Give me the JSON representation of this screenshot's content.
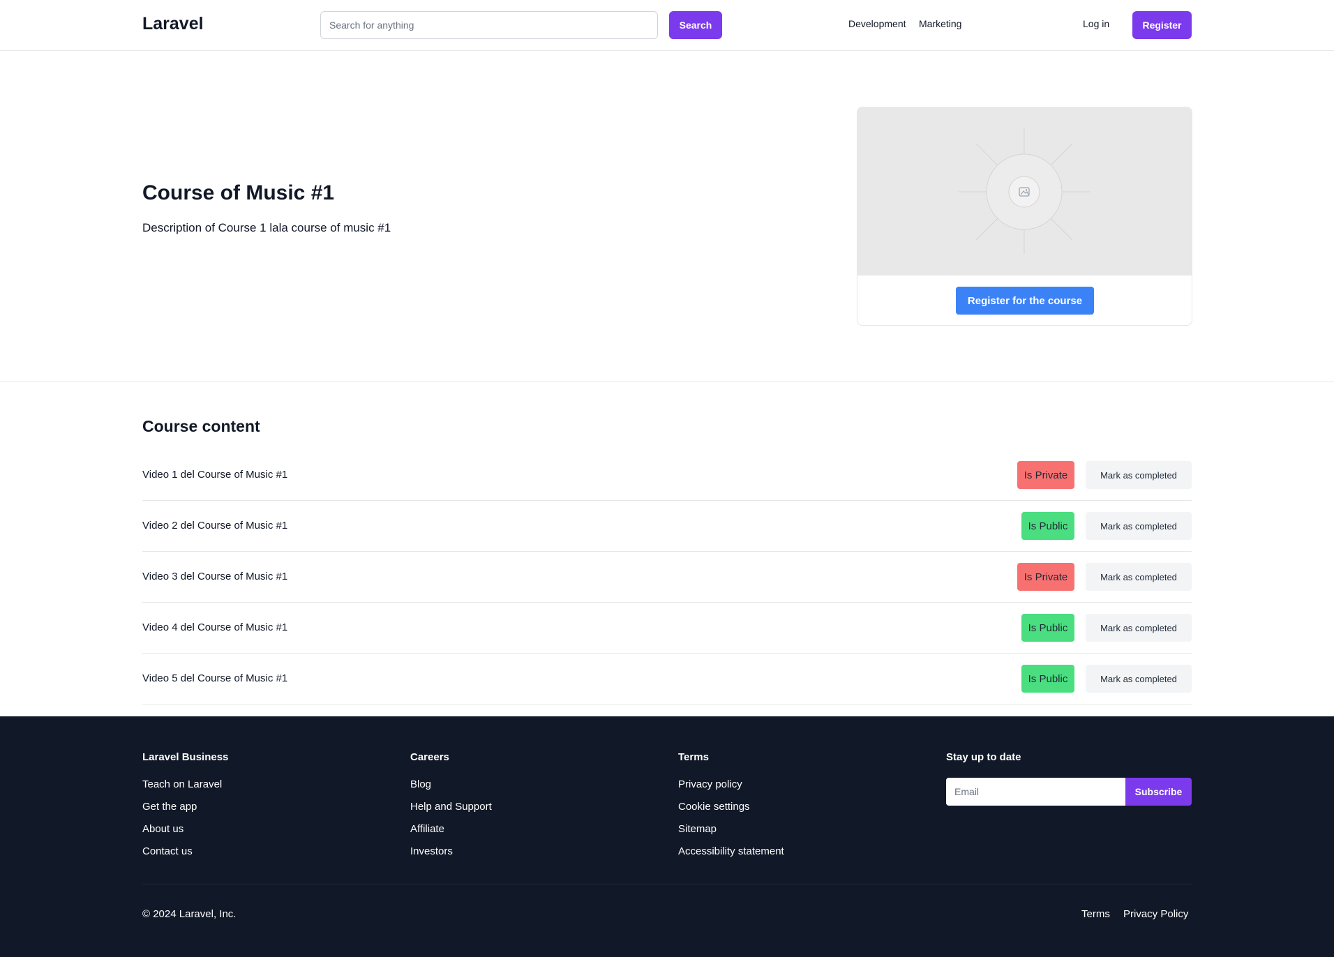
{
  "header": {
    "brand": "Laravel",
    "search_placeholder": "Search for anything",
    "search_button": "Search",
    "nav": [
      "Development",
      "Marketing"
    ],
    "login": "Log in",
    "register": "Register"
  },
  "hero": {
    "title": "Course of Music #1",
    "description": "Description of Course 1 lala course of music #1",
    "cta": "Register for the course"
  },
  "content": {
    "title": "Course content",
    "videos": [
      {
        "title": "Video 1 del Course of Music #1",
        "status": "Is Private",
        "action": "Mark as completed"
      },
      {
        "title": "Video 2 del Course of Music #1",
        "status": "Is Public",
        "action": "Mark as completed"
      },
      {
        "title": "Video 3 del Course of Music #1",
        "status": "Is Private",
        "action": "Mark as completed"
      },
      {
        "title": "Video 4 del Course of Music #1",
        "status": "Is Public",
        "action": "Mark as completed"
      },
      {
        "title": "Video 5 del Course of Music #1",
        "status": "Is Public",
        "action": "Mark as completed"
      }
    ]
  },
  "footer": {
    "columns": [
      {
        "heading": "Laravel Business",
        "links": [
          "Teach on Laravel",
          "Get the app",
          "About us",
          "Contact us"
        ]
      },
      {
        "heading": "Careers",
        "links": [
          "Blog",
          "Help and Support",
          "Affiliate",
          "Investors"
        ]
      },
      {
        "heading": "Terms",
        "links": [
          "Privacy policy",
          "Cookie settings",
          "Sitemap",
          "Accessibility statement"
        ]
      }
    ],
    "newsletter": {
      "heading": "Stay up to date",
      "email_placeholder": "Email",
      "subscribe": "Subscribe"
    },
    "copyright": "© 2024 Laravel, Inc.",
    "legal": [
      "Terms",
      "Privacy Policy"
    ]
  },
  "colors": {
    "accent": "#7c3aed",
    "primary_button": "#3b82f6",
    "private": "#f87171",
    "public": "#4ade80",
    "footer_bg": "#111827"
  },
  "icons": {
    "image_placeholder": "image-icon"
  }
}
